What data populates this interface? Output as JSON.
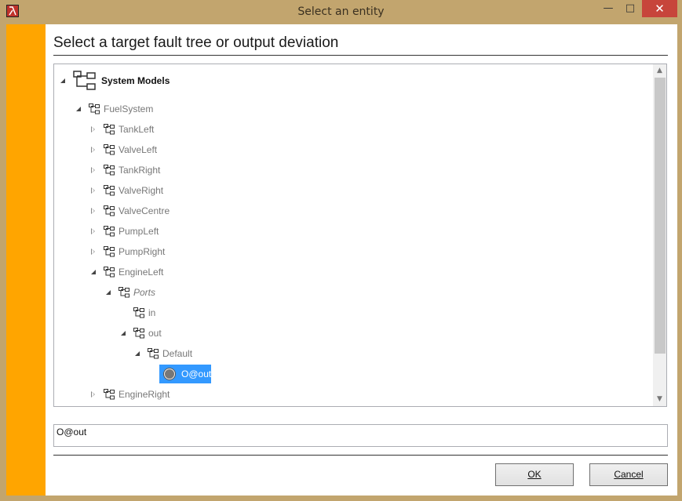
{
  "window": {
    "title": "Select an entity"
  },
  "heading": "Select a target fault tree or output deviation",
  "tree": {
    "root": "System Models",
    "nodes": [
      {
        "label": "FuelSystem"
      },
      {
        "label": "TankLeft"
      },
      {
        "label": "ValveLeft"
      },
      {
        "label": "TankRight"
      },
      {
        "label": "ValveRight"
      },
      {
        "label": "ValveCentre"
      },
      {
        "label": "PumpLeft"
      },
      {
        "label": "PumpRight"
      },
      {
        "label": "EngineLeft"
      },
      {
        "label": "Ports"
      },
      {
        "label": "in"
      },
      {
        "label": "out"
      },
      {
        "label": "Default"
      },
      {
        "label": "O@out"
      },
      {
        "label": "EngineRight"
      }
    ]
  },
  "path_field": {
    "value": "O@out"
  },
  "buttons": {
    "ok_label": "OK",
    "cancel_label": "Cancel"
  },
  "colors": {
    "sidebar": "#ffa500",
    "selection": "#3399ff",
    "frame": "#c2a56e",
    "close": "#c7453b"
  }
}
